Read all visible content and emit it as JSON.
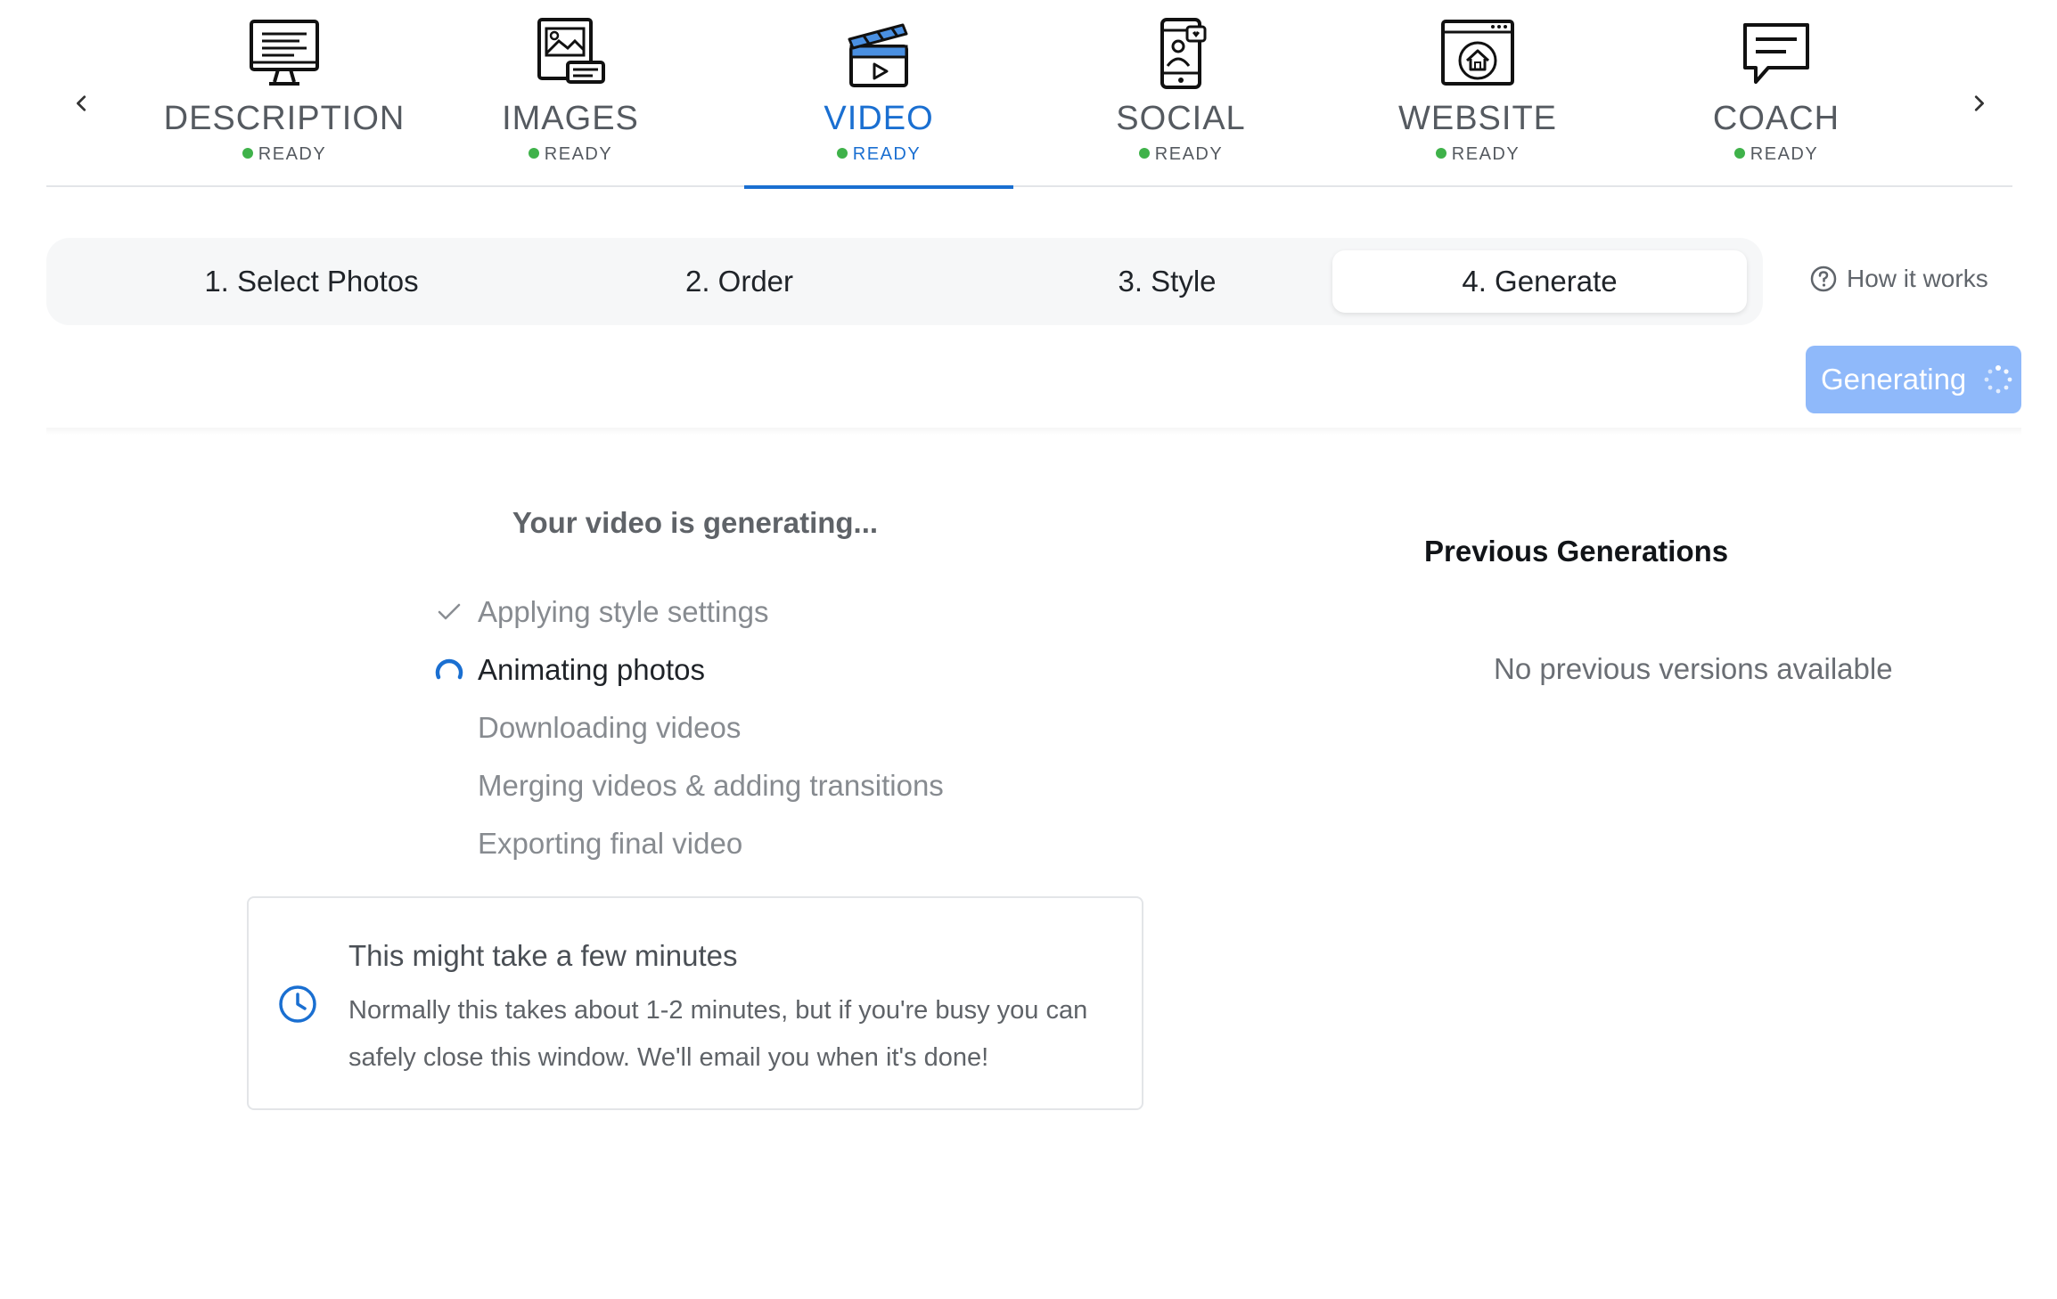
{
  "top_tabs": [
    {
      "label": "DESCRIPTION",
      "status": "READY",
      "icon": "monitor-text-icon",
      "active": false
    },
    {
      "label": "IMAGES",
      "status": "READY",
      "icon": "images-icon",
      "active": false
    },
    {
      "label": "VIDEO",
      "status": "READY",
      "icon": "clapperboard-icon",
      "active": true
    },
    {
      "label": "SOCIAL",
      "status": "READY",
      "icon": "phone-social-icon",
      "active": false
    },
    {
      "label": "WEBSITE",
      "status": "READY",
      "icon": "browser-home-icon",
      "active": false
    },
    {
      "label": "COACH",
      "status": "READY",
      "icon": "chat-bubble-icon",
      "active": false
    }
  ],
  "stepper": {
    "steps": [
      {
        "label": "1. Select Photos",
        "active": false
      },
      {
        "label": "2. Order",
        "active": false
      },
      {
        "label": "3. Style",
        "active": false
      },
      {
        "label": "4. Generate",
        "active": true
      }
    ],
    "how_it_works": "How it works"
  },
  "generate_button": {
    "label": "Generating",
    "state": "loading"
  },
  "progress": {
    "heading": "Your video is generating...",
    "steps": [
      {
        "label": "Applying style settings",
        "state": "done"
      },
      {
        "label": "Animating photos",
        "state": "in-progress"
      },
      {
        "label": "Downloading videos",
        "state": "pending"
      },
      {
        "label": "Merging videos & adding transitions",
        "state": "pending"
      },
      {
        "label": "Exporting final video",
        "state": "pending"
      }
    ]
  },
  "notice": {
    "title": "This might take a few minutes",
    "text": "Normally this takes about 1-2 minutes, but if you're busy you can safely close this window. We'll email you when it's done!"
  },
  "previous": {
    "title": "Previous Generations",
    "empty": "No previous versions available"
  },
  "colors": {
    "accent": "#1a6fd1",
    "ready_dot": "#3fb24a",
    "button_loading": "#8fb9fa",
    "icon_blue": "#4a90e2"
  }
}
